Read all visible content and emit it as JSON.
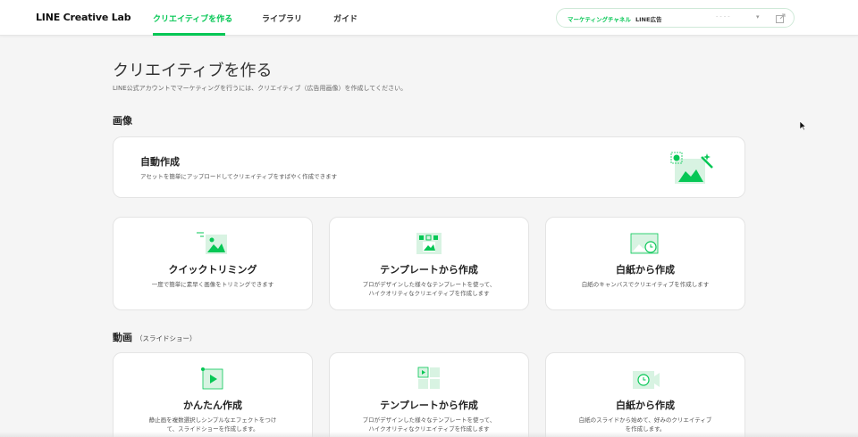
{
  "header": {
    "logo": "LINE Creative Lab",
    "nav": [
      {
        "label": "クリエイティブを作る",
        "active": true
      },
      {
        "label": "ライブラリ",
        "active": false
      },
      {
        "label": "ガイド",
        "active": false
      }
    ],
    "account": {
      "channel_label": "マーケティングチャネル",
      "account_name": "LINE広告",
      "selected_value": "- - - -"
    }
  },
  "page": {
    "title": "クリエイティブを作る",
    "description": "LINE公式アカウントでマーケティングを行うには、クリエイティブ（広告用画像）を作成してください。"
  },
  "image_section": {
    "title": "画像",
    "auto_card": {
      "title": "自動作成",
      "description": "アセットを簡単にアップロードしてクリエイティブをすばやく作成できます",
      "icon": "auto-create-icon"
    },
    "cards": [
      {
        "title": "クイックトリミング",
        "description": "一度で簡単に素早く画像をトリミングできます",
        "icon": "quick-trim-icon"
      },
      {
        "title": "テンプレートから作成",
        "description": "プロがデザインした様々なテンプレートを使って、\nハイクオリティなクリエイティブを作成します",
        "icon": "template-icon"
      },
      {
        "title": "白紙から作成",
        "description": "白紙のキャンバスでクリエイティブを作成します",
        "icon": "blank-canvas-icon"
      }
    ]
  },
  "video_section": {
    "title": "動画",
    "subtitle": "（スライドショー）",
    "cards": [
      {
        "title": "かんたん作成",
        "description": "静止画を複数選択しシンプルなエフェクトをつけ\nて、スライドショーを作成します。",
        "icon": "easy-video-icon"
      },
      {
        "title": "テンプレートから作成",
        "description": "プロがデザインした様々なテンプレートを使って、\nハイクオリティなクリエイティブを作成します",
        "icon": "video-template-icon"
      },
      {
        "title": "白紙から作成",
        "description": "白紙のスライドから始めて、好みのクリエイティブ\nを作成します。",
        "icon": "blank-video-icon"
      }
    ]
  },
  "colors": {
    "accent": "#06c755",
    "icon_light": "#d8f3e2"
  }
}
